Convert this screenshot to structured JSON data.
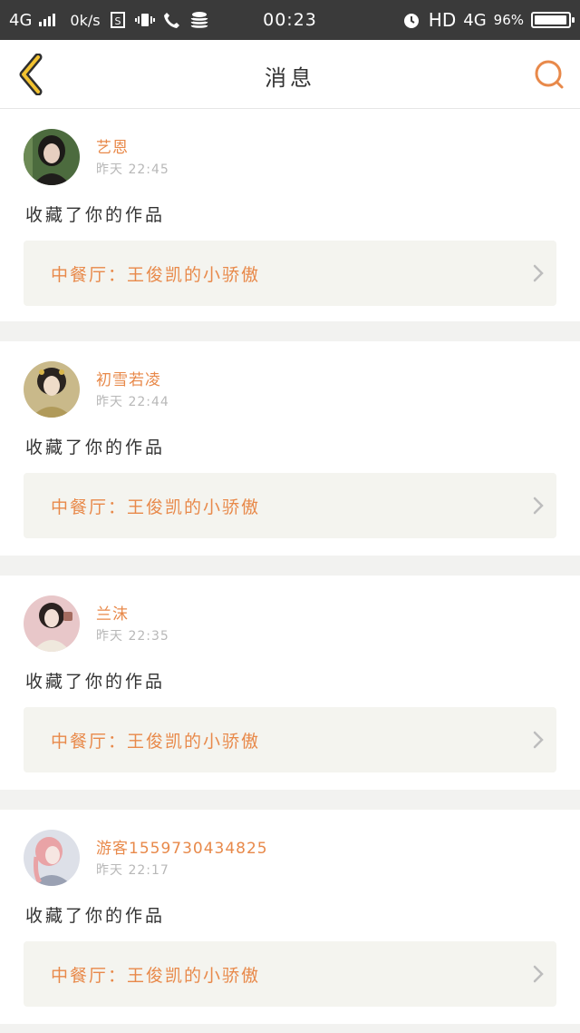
{
  "status_bar": {
    "network": "4G",
    "speed": "0k/s",
    "time": "00:23",
    "hd": "HD",
    "network_right": "4G",
    "battery": "96%",
    "battery_level": 0.96
  },
  "header": {
    "title": "消息",
    "back_icon": "chevron-left-icon",
    "search_icon": "search-icon"
  },
  "colors": {
    "accent": "#e8894a",
    "back_arrow": "#f2c230",
    "status_bar_bg": "#3a3a3a",
    "card_link_bg": "#f4f4ef"
  },
  "messages": [
    {
      "username": "艺恩",
      "timestamp": "昨天 22:45",
      "action": "收藏了你的作品",
      "work_title": "中餐厅：王俊凯的小骄傲"
    },
    {
      "username": "初雪若凌",
      "timestamp": "昨天 22:44",
      "action": "收藏了你的作品",
      "work_title": "中餐厅：王俊凯的小骄傲"
    },
    {
      "username": "兰沫",
      "timestamp": "昨天 22:35",
      "action": "收藏了你的作品",
      "work_title": "中餐厅：王俊凯的小骄傲"
    },
    {
      "username": "游客15597304348​25",
      "timestamp": "昨天 22:17",
      "action": "收藏了你的作品",
      "work_title": "中餐厅：王俊凯的小骄傲"
    }
  ]
}
